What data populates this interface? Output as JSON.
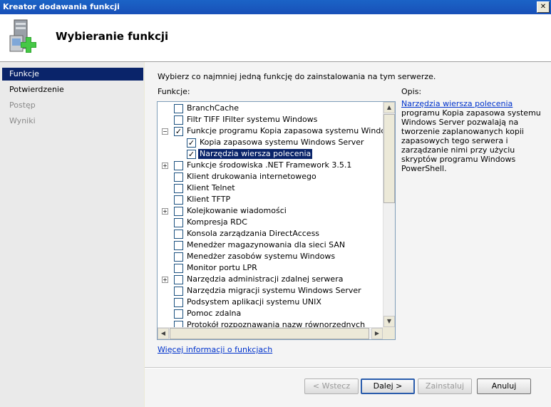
{
  "window": {
    "title": "Kreator dodawania funkcji",
    "close_glyph": "✕"
  },
  "header": {
    "title": "Wybieranie funkcji",
    "icon": "server-add-icon"
  },
  "sidebar": {
    "items": [
      {
        "label": "Funkcje",
        "state": "active"
      },
      {
        "label": "Potwierdzenie",
        "state": "normal"
      },
      {
        "label": "Postęp",
        "state": "disabled"
      },
      {
        "label": "Wyniki",
        "state": "disabled"
      }
    ]
  },
  "main": {
    "instruction": "Wybierz co najmniej jedną funkcję do zainstalowania na tym serwerze.",
    "features_label": "Funkcje:",
    "description_label": "Opis:",
    "description_link": "Narzędzia wiersza polecenia",
    "description_text": " programu Kopia zapasowa systemu Windows Server pozwalają na tworzenie zaplanowanych kopii zapasowych tego serwera i zarządzanie nimi przy użyciu skryptów programu Windows PowerShell.",
    "more_info_link": "Więcej informacji o funkcjach",
    "features": [
      {
        "label": "BranchCache",
        "checked": false,
        "expander": "",
        "level": 0
      },
      {
        "label": "Filtr TIFF IFilter systemu Windows",
        "checked": false,
        "expander": "",
        "level": 0
      },
      {
        "label": "Funkcje programu Kopia zapasowa systemu Windows Server",
        "checked": true,
        "expander": "−",
        "level": 0
      },
      {
        "label": "Kopia zapasowa systemu Windows Server",
        "checked": true,
        "expander": "",
        "level": 1
      },
      {
        "label": "Narzędzia wiersza polecenia",
        "checked": true,
        "expander": "",
        "level": 1,
        "selected": true
      },
      {
        "label": "Funkcje środowiska .NET Framework 3.5.1",
        "checked": false,
        "expander": "+",
        "level": 0
      },
      {
        "label": "Klient drukowania internetowego",
        "checked": false,
        "expander": "",
        "level": 0
      },
      {
        "label": "Klient Telnet",
        "checked": false,
        "expander": "",
        "level": 0
      },
      {
        "label": "Klient TFTP",
        "checked": false,
        "expander": "",
        "level": 0
      },
      {
        "label": "Kolejkowanie wiadomości",
        "checked": false,
        "expander": "+",
        "level": 0
      },
      {
        "label": "Kompresja RDC",
        "checked": false,
        "expander": "",
        "level": 0
      },
      {
        "label": "Konsola zarządzania DirectAccess",
        "checked": false,
        "expander": "",
        "level": 0
      },
      {
        "label": "Menedżer magazynowania dla sieci SAN",
        "checked": false,
        "expander": "",
        "level": 0
      },
      {
        "label": "Menedżer zasobów systemu Windows",
        "checked": false,
        "expander": "",
        "level": 0
      },
      {
        "label": "Monitor portu LPR",
        "checked": false,
        "expander": "",
        "level": 0
      },
      {
        "label": "Narzędzia administracji zdalnej serwera",
        "checked": false,
        "expander": "+",
        "level": 0
      },
      {
        "label": "Narzędzia migracji systemu Windows Server",
        "checked": false,
        "expander": "",
        "level": 0
      },
      {
        "label": "Podsystem aplikacji systemu UNIX",
        "checked": false,
        "expander": "",
        "level": 0
      },
      {
        "label": "Pomoc zdalna",
        "checked": false,
        "expander": "",
        "level": 0
      },
      {
        "label": "Protokół rozpoznawania nazw równorzędnych",
        "checked": false,
        "expander": "",
        "level": 0
      }
    ]
  },
  "buttons": {
    "back": "< Wstecz",
    "next": "Dalej >",
    "install": "Zainstaluj",
    "cancel": "Anuluj"
  },
  "scroll_glyphs": {
    "up": "▲",
    "down": "▼",
    "left": "◀",
    "right": "▶"
  },
  "check_glyph": "✓"
}
